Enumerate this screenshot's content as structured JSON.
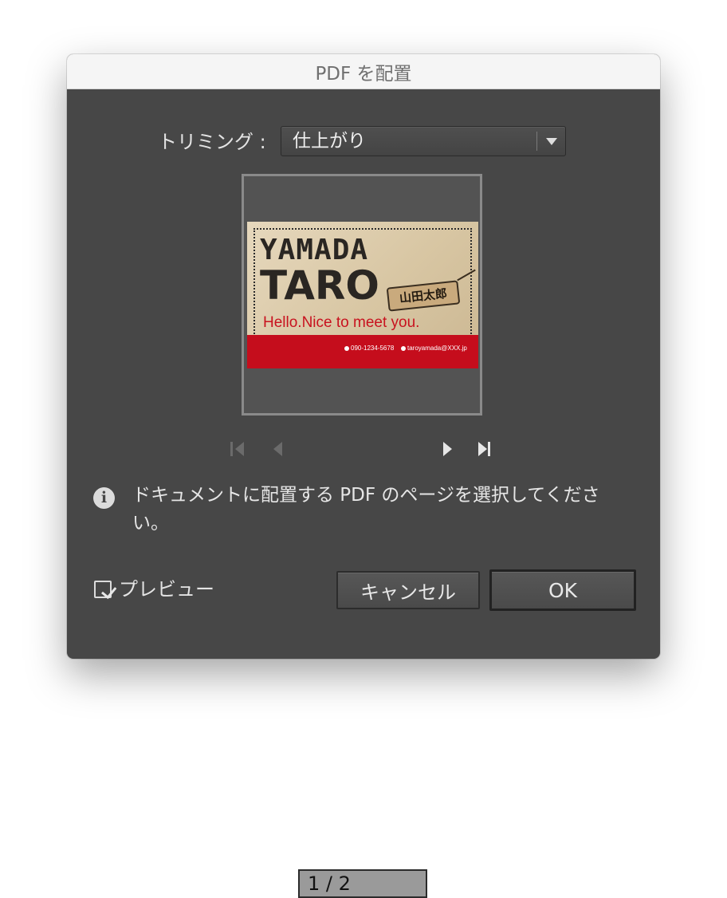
{
  "dialog": {
    "title": "PDF を配置"
  },
  "trimming": {
    "label": "トリミング :",
    "selected": "仕上がり"
  },
  "preview_card": {
    "name_line1": "YAMADA",
    "name_line2": "TARO",
    "tag": "山田太郎",
    "greeting": "Hello.Nice to meet you.",
    "phone": "090-1234-5678",
    "email": "taroyamada@XXX.jp",
    "colors": {
      "paper": "#dccbaa",
      "band": "#c50d1c",
      "greeting": "#c8121f"
    }
  },
  "pager": {
    "page_value": "1 / 2",
    "first_icon": "first-page-icon",
    "prev_icon": "previous-page-icon",
    "next_icon": "next-page-icon",
    "last_icon": "last-page-icon"
  },
  "info": {
    "icon": "info-icon",
    "message": "ドキュメントに配置する PDF のページを選択してください。"
  },
  "preview_option": {
    "label": "プレビュー",
    "checked": true
  },
  "buttons": {
    "cancel": "キャンセル",
    "ok": "OK"
  }
}
